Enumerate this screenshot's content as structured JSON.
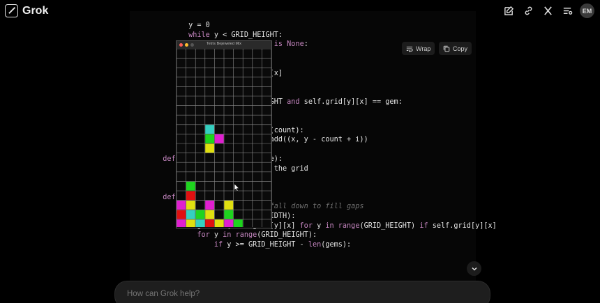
{
  "app": {
    "name": "Grok",
    "avatar_initials": "EM"
  },
  "topbar_icons": [
    "edit-icon",
    "link-icon",
    "x-icon",
    "history-icon"
  ],
  "code_toolbar": {
    "wrap_label": "Wrap",
    "copy_label": "Copy"
  },
  "code": {
    "lines": [
      "        y = 0",
      "        while y < GRID_HEIGHT:",
      "                          ] is None:",
      "",
      "",
      "                          ][x]",
      "",
      "",
      "                          HGHT and self.grid[y][x] == gem:",
      "",
      "",
      "                          e(count):",
      "                          .add((x, y - count + i))",
      "      r",
      "  def r                   ve):",
      "                          = the grid",
      "      I",
      "                          e",
      "  def fall_gems(self):",
      "      # Let remaining gems fall down to fill gaps",
      "      for x in range(GRID_WIDTH):",
      "          gems = [self.grid[y][x] for y in range(GRID_HEIGHT) if self.grid[y][x]",
      "          for y in range(GRID_HEIGHT):",
      "              if y >= GRID_HEIGHT - len(gems):"
    ]
  },
  "tetris": {
    "title": "Tetris Bejeweled Mix",
    "cols": 10,
    "rows": 19,
    "colors": {
      "C": "#35d0c0",
      "G": "#1ed41e",
      "M": "#e01fd0",
      "Y": "#e0e010",
      "R": "#e01010",
      "B": "#1040e0"
    },
    "cells": [
      {
        "r": 8,
        "c": 3,
        "k": "C"
      },
      {
        "r": 9,
        "c": 3,
        "k": "G"
      },
      {
        "r": 9,
        "c": 4,
        "k": "M"
      },
      {
        "r": 10,
        "c": 3,
        "k": "Y"
      },
      {
        "r": 14,
        "c": 1,
        "k": "G"
      },
      {
        "r": 15,
        "c": 1,
        "k": "R"
      },
      {
        "r": 16,
        "c": 0,
        "k": "M"
      },
      {
        "r": 16,
        "c": 1,
        "k": "Y"
      },
      {
        "r": 16,
        "c": 3,
        "k": "M"
      },
      {
        "r": 16,
        "c": 5,
        "k": "Y"
      },
      {
        "r": 17,
        "c": 0,
        "k": "R"
      },
      {
        "r": 17,
        "c": 1,
        "k": "C"
      },
      {
        "r": 17,
        "c": 2,
        "k": "G"
      },
      {
        "r": 17,
        "c": 3,
        "k": "Y"
      },
      {
        "r": 17,
        "c": 5,
        "k": "G"
      },
      {
        "r": 18,
        "c": 0,
        "k": "M"
      },
      {
        "r": 18,
        "c": 1,
        "k": "Y"
      },
      {
        "r": 18,
        "c": 2,
        "k": "C"
      },
      {
        "r": 18,
        "c": 3,
        "k": "R"
      },
      {
        "r": 18,
        "c": 4,
        "k": "Y"
      },
      {
        "r": 18,
        "c": 5,
        "k": "M"
      },
      {
        "r": 18,
        "c": 6,
        "k": "G"
      },
      {
        "r": 19,
        "c": 0,
        "k": "M"
      },
      {
        "r": 19,
        "c": 1,
        "k": "R"
      },
      {
        "r": 19,
        "c": 2,
        "k": "B"
      },
      {
        "r": 19,
        "c": 3,
        "k": "G"
      },
      {
        "r": 19,
        "c": 4,
        "k": "R"
      },
      {
        "r": 19,
        "c": 5,
        "k": "B"
      },
      {
        "r": 19,
        "c": 6,
        "k": "C"
      }
    ]
  },
  "chat": {
    "placeholder": "How can Grok help?"
  }
}
